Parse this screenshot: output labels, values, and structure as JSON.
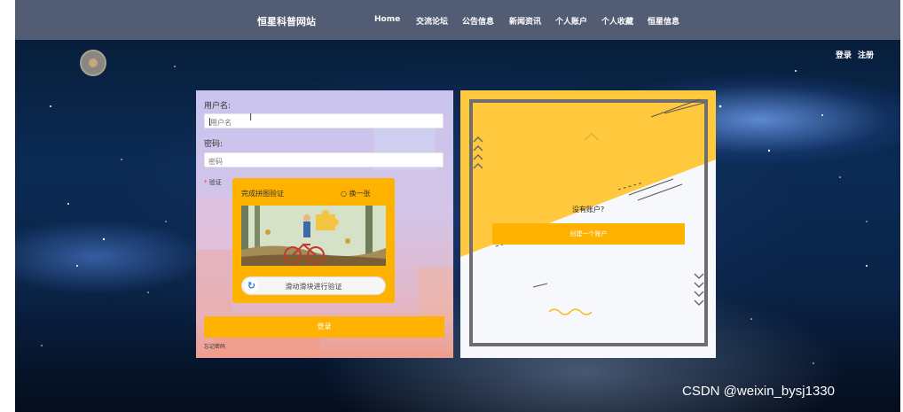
{
  "header": {
    "site_title": "恒星科普网站",
    "nav": [
      "Home",
      "交流论坛",
      "公告信息",
      "新闻资讯",
      "个人账户",
      "个人收藏",
      "恒星信息"
    ],
    "login": "登录",
    "register": "注册"
  },
  "login_form": {
    "username_label": "用户名:",
    "username_placeholder": "用户名",
    "password_label": "密码:",
    "password_placeholder": "密码",
    "verify_label": "验证",
    "captcha": {
      "title": "完成拼图验证",
      "refresh": "换一张",
      "slider_text": "滑动滑块进行验证"
    },
    "login_button": "登录",
    "forgot_password": "忘记密码"
  },
  "register_panel": {
    "prompt": "没有账户?",
    "create_button": "创建一个账户"
  },
  "watermark": "CSDN @weixin_bysj1330",
  "colors": {
    "navbar": "#525d73",
    "accent": "#ffb200",
    "panel_yellow": "#ffc83d"
  }
}
